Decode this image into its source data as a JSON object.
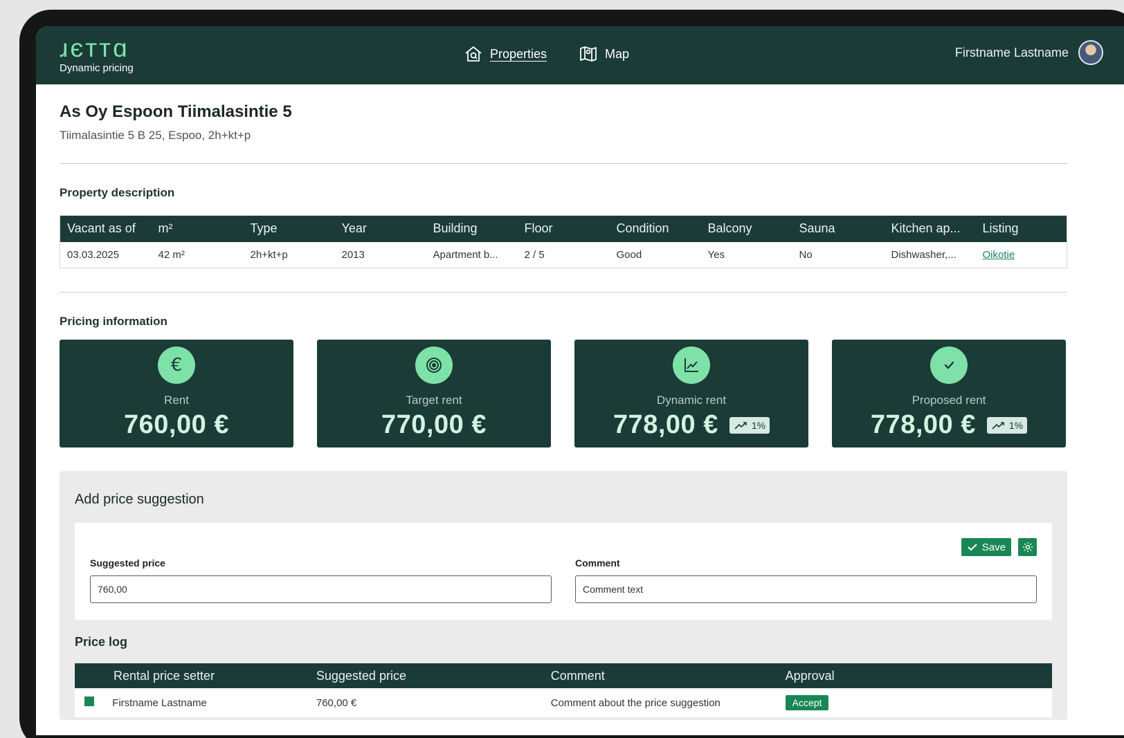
{
  "brand": {
    "name": "ɹєттɑ",
    "tagline": "Dynamic pricing"
  },
  "nav": [
    {
      "label": "Properties",
      "icon": "home-search-icon",
      "active": true
    },
    {
      "label": "Map",
      "icon": "map-pin-icon",
      "active": false
    }
  ],
  "user": {
    "name": "Firstname Lastname"
  },
  "property": {
    "title": "As Oy Espoon Tiimalasintie 5",
    "subtitle": "Tiimalasintie 5 B 25, Espoo, 2h+kt+p"
  },
  "description": {
    "heading": "Property description",
    "columns": [
      "Vacant as of",
      "m²",
      "Type",
      "Year",
      "Building",
      "Floor",
      "Condition",
      "Balcony",
      "Sauna",
      "Kitchen ap...",
      "Listing"
    ],
    "row": [
      "03.03.2025",
      "42 m²",
      "2h+kt+p",
      "2013",
      "Apartment b...",
      "2 / 5",
      "Good",
      "Yes",
      "No",
      "Dishwasher,...",
      "Oikotie"
    ]
  },
  "pricing": {
    "heading": "Pricing information",
    "cards": [
      {
        "label": "Rent",
        "value": "760,00 €",
        "icon": "euro-icon",
        "trend": null
      },
      {
        "label": "Target rent",
        "value": "770,00 €",
        "icon": "target-icon",
        "trend": null
      },
      {
        "label": "Dynamic rent",
        "value": "778,00 €",
        "icon": "chart-line-icon",
        "trend": "1%"
      },
      {
        "label": "Proposed rent",
        "value": "778,00 €",
        "icon": "check-icon",
        "trend": "1%"
      }
    ]
  },
  "suggestion": {
    "heading": "Add price suggestion",
    "save_label": "Save",
    "price_label": "Suggested price",
    "price_value": "760,00",
    "comment_label": "Comment",
    "comment_value": "Comment text"
  },
  "price_log": {
    "heading": "Price log",
    "columns": [
      "Rental price setter",
      "Suggested price",
      "Comment",
      "Approval"
    ],
    "rows": [
      {
        "setter": "Firstname Lastname",
        "price": "760,00 €",
        "comment": "Comment about the price suggestion",
        "approval": "Accept"
      }
    ]
  },
  "colors": {
    "primary": "#1b3b37",
    "accent": "#7ee2a8",
    "button": "#198754",
    "background": "#e6e6e6"
  }
}
